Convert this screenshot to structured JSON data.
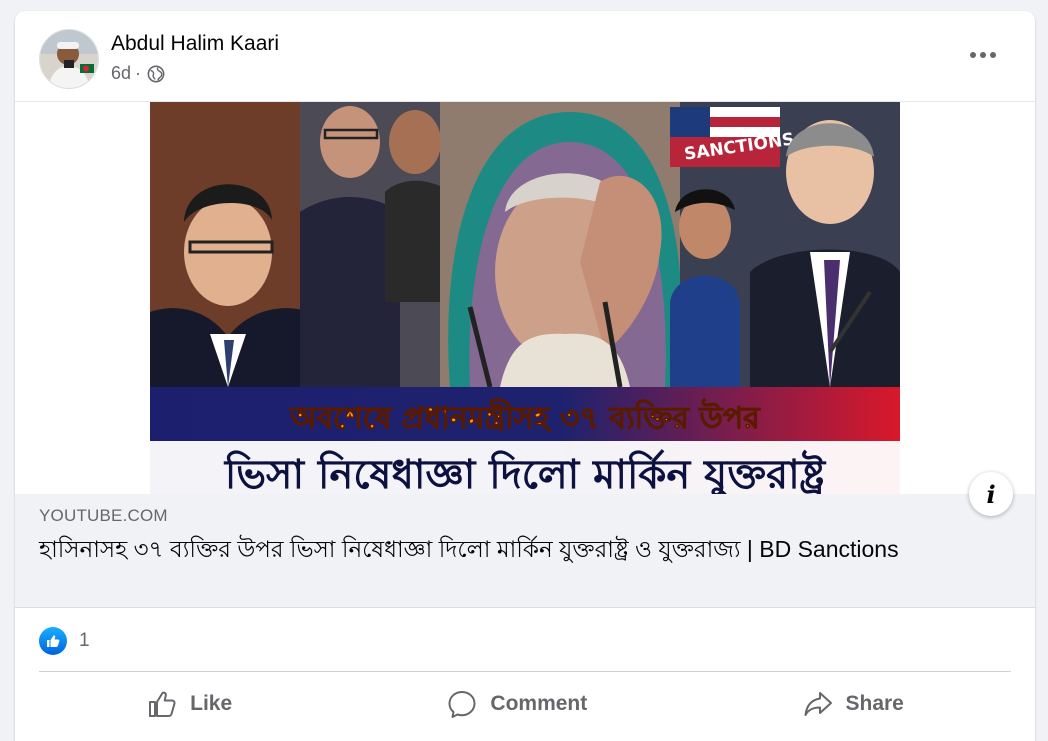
{
  "post": {
    "author": "Abdul Halim Kaari",
    "time": "6d",
    "dot": "·",
    "privacy_icon": "globe-icon",
    "more_icon": "more-horizontal-icon"
  },
  "thumbnail": {
    "overlay_badge": "SANCTIONS",
    "headline_line1": "অবশেষে প্রধানমন্ত্রীসহ ৩৭ ব্যক্তির উপর",
    "headline_line2": "ভিসা নিষেধাজ্ঞা দিলো মার্কিন যুক্তরাষ্ট্র"
  },
  "link": {
    "domain": "YOUTUBE.COM",
    "title": "হাসিনাসহ ৩৭ ব্যক্তির উপর ভিসা নিষেধাজ্ঞা দিলো মার্কিন যুক্তরাষ্ট্র ও যুক্তরাজ্য | BD Sanctions",
    "info_icon": "i"
  },
  "reactions": {
    "icon": "like-icon",
    "count": "1"
  },
  "actions": {
    "like": "Like",
    "comment": "Comment",
    "share": "Share"
  },
  "colors": {
    "background": "#f0f2f5",
    "card": "#ffffff",
    "secondary_text": "#65676b",
    "like_blue": "#0866ff",
    "banner_blue": "#1c1f6e",
    "banner_red": "#d9182a",
    "headline_orange": "#ff9a1a"
  }
}
